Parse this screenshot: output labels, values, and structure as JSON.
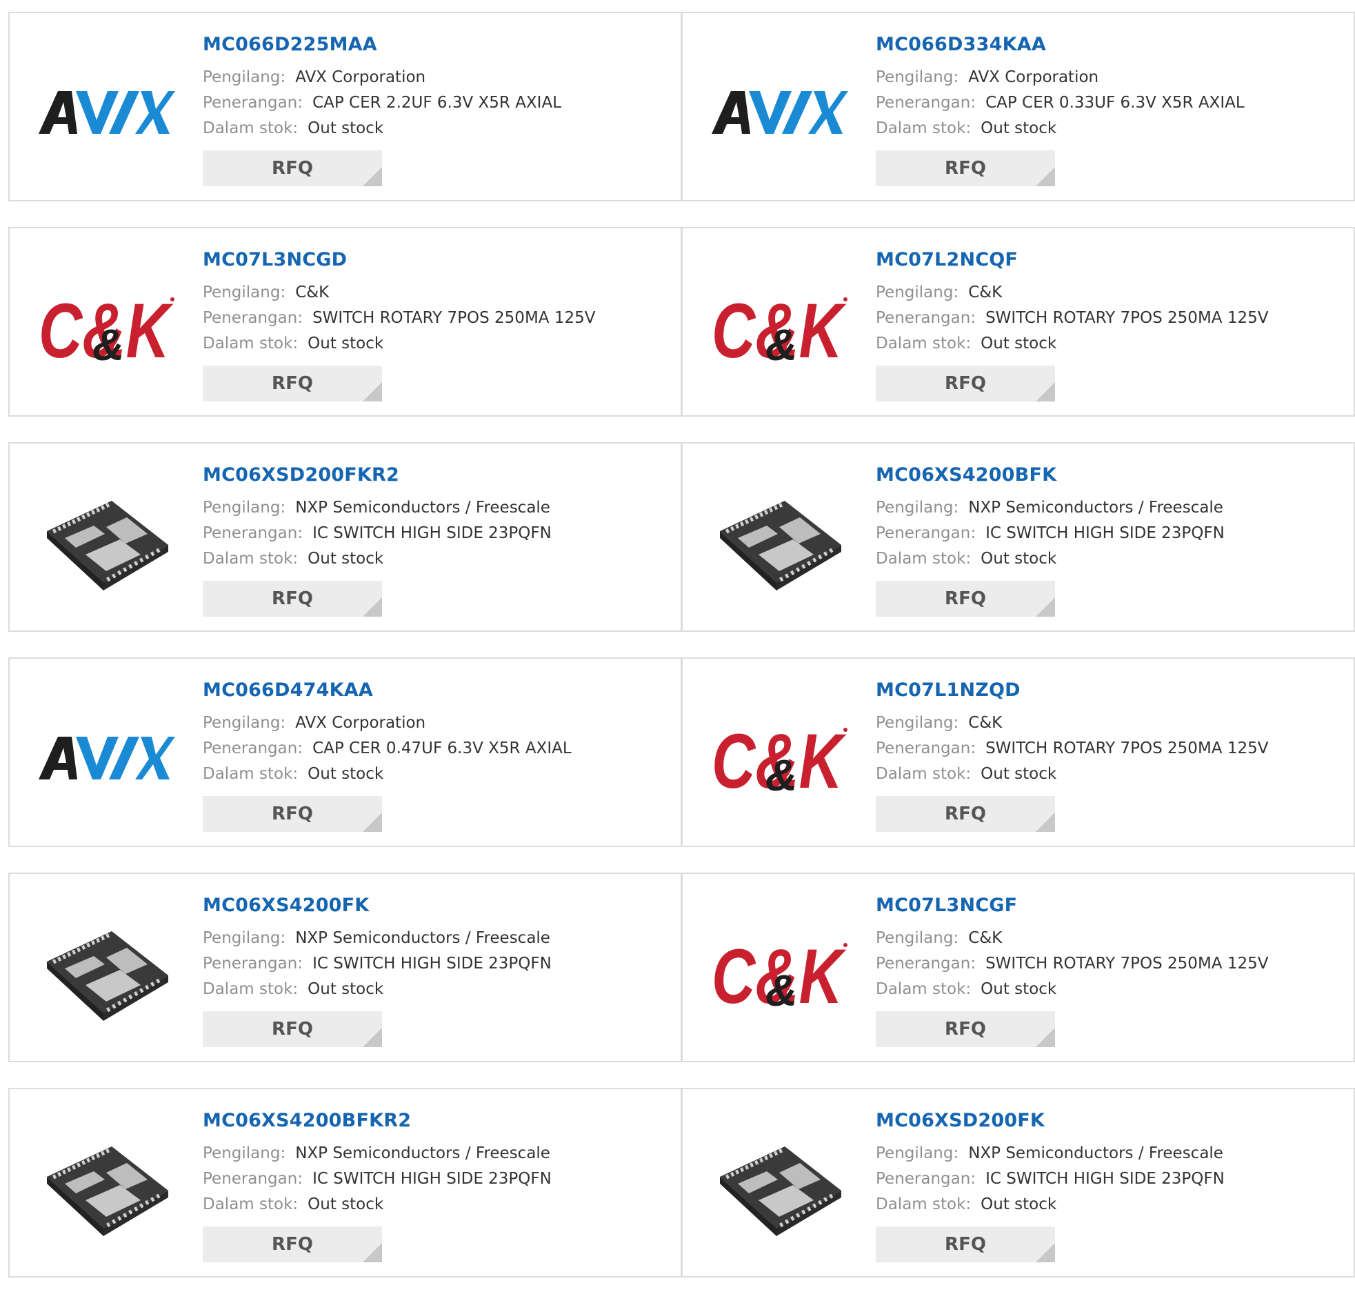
{
  "labels": {
    "manufacturer": "Pengilang:",
    "description": "Penerangan:",
    "stock": "Dalam stok:",
    "rfq": "RFQ"
  },
  "colors": {
    "part_link": "#1565b0",
    "avx_blue": "#1a8ad4",
    "ck_red": "#c8202e"
  },
  "rows": [
    [
      {
        "part": "MC066D225MAA",
        "logo": "avx-logo",
        "manufacturer": "AVX Corporation",
        "description": "CAP CER 2.2UF 6.3V X5R AXIAL",
        "stock": "Out stock"
      },
      {
        "part": "MC066D334KAA",
        "logo": "avx-logo",
        "manufacturer": "AVX Corporation",
        "description": "CAP CER 0.33UF 6.3V X5R AXIAL",
        "stock": "Out stock"
      }
    ],
    [
      {
        "part": "MC07L3NCGD",
        "logo": "ck-logo",
        "manufacturer": "C&K",
        "description": "SWITCH ROTARY 7POS 250MA 125V",
        "stock": "Out stock"
      },
      {
        "part": "MC07L2NCQF",
        "logo": "ck-logo",
        "manufacturer": "C&K",
        "description": "SWITCH ROTARY 7POS 250MA 125V",
        "stock": "Out stock"
      }
    ],
    [
      {
        "part": "MC06XSD200FKR2",
        "logo": "chip-image",
        "manufacturer": "NXP Semiconductors / Freescale",
        "description": "IC SWITCH HIGH SIDE 23PQFN",
        "stock": "Out stock"
      },
      {
        "part": "MC06XS4200BFK",
        "logo": "chip-image",
        "manufacturer": "NXP Semiconductors / Freescale",
        "description": "IC SWITCH HIGH SIDE 23PQFN",
        "stock": "Out stock"
      }
    ],
    [
      {
        "part": "MC066D474KAA",
        "logo": "avx-logo",
        "manufacturer": "AVX Corporation",
        "description": "CAP CER 0.47UF 6.3V X5R AXIAL",
        "stock": "Out stock"
      },
      {
        "part": "MC07L1NZQD",
        "logo": "ck-logo",
        "manufacturer": "C&K",
        "description": "SWITCH ROTARY 7POS 250MA 125V",
        "stock": "Out stock"
      }
    ],
    [
      {
        "part": "MC06XS4200FK",
        "logo": "chip-image",
        "manufacturer": "NXP Semiconductors / Freescale",
        "description": "IC SWITCH HIGH SIDE 23PQFN",
        "stock": "Out stock"
      },
      {
        "part": "MC07L3NCGF",
        "logo": "ck-logo",
        "manufacturer": "C&K",
        "description": "SWITCH ROTARY 7POS 250MA 125V",
        "stock": "Out stock"
      }
    ],
    [
      {
        "part": "MC06XS4200BFKR2",
        "logo": "chip-image",
        "manufacturer": "NXP Semiconductors / Freescale",
        "description": "IC SWITCH HIGH SIDE 23PQFN",
        "stock": "Out stock"
      },
      {
        "part": "MC06XSD200FK",
        "logo": "chip-image",
        "manufacturer": "NXP Semiconductors / Freescale",
        "description": "IC SWITCH HIGH SIDE 23PQFN",
        "stock": "Out stock"
      }
    ]
  ]
}
